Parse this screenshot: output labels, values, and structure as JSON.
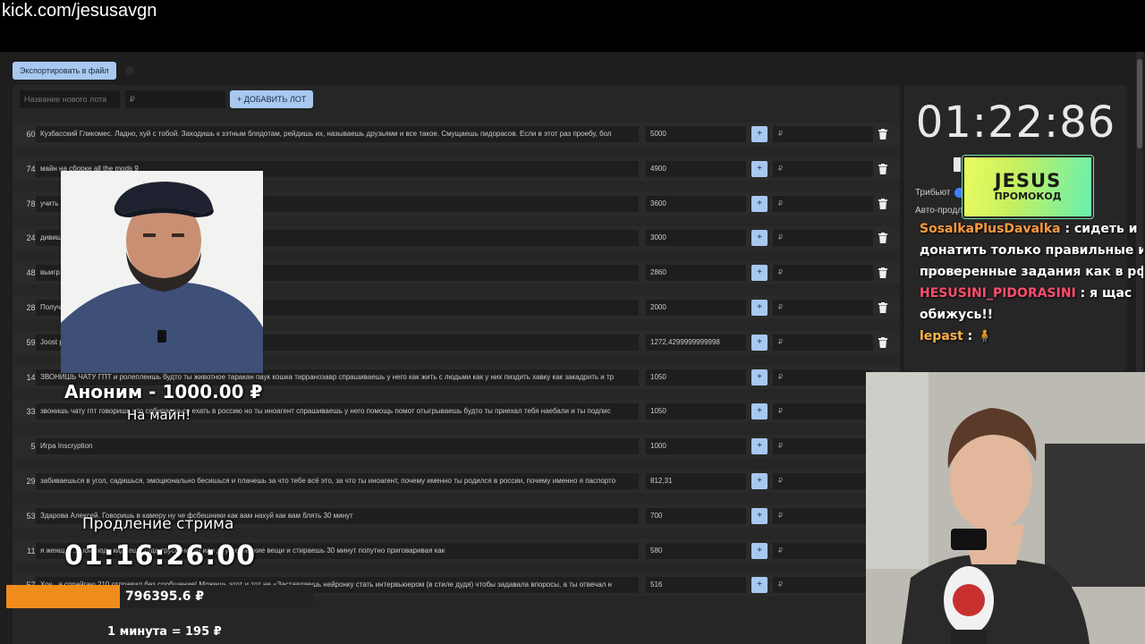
{
  "browser": {
    "url": "kick.com/jesusavgn"
  },
  "toolbar": {
    "export_label": "Экспортировать в файл"
  },
  "new_lot": {
    "name_placeholder": "Название нового лота",
    "price_placeholder": "₽",
    "add_label": "+ ДОБАВИТЬ ЛОТ"
  },
  "lots": [
    {
      "num": "60.",
      "desc": "Кузбасский Гликомес. Ладно, хуй с тобой. Заходишь к зэтным блядотам, рейдишь их, называешь друзьями и все такое. Смущаешь пидорасов. Если в этот раз проебу, бол",
      "amount": "5000",
      "plus": "+",
      "add_placeholder": "₽"
    },
    {
      "num": "74.",
      "desc": "майн на сборке all the mods 9",
      "amount": "4900",
      "plus": "+",
      "add_placeholder": "₽"
    },
    {
      "num": "78.",
      "desc": "учить",
      "amount": "3600",
      "plus": "+",
      "add_placeholder": "₽"
    },
    {
      "num": "24.",
      "desc": "дивиш",
      "amount": "3000",
      "plus": "+",
      "add_placeholder": "₽"
    },
    {
      "num": "48.",
      "desc": "выигр",
      "amount": "2860",
      "plus": "+",
      "add_placeholder": "₽"
    },
    {
      "num": "28.",
      "desc": "Получ                                                                                              ы",
      "amount": "2000",
      "plus": "+",
      "add_placeholder": "₽"
    },
    {
      "num": "59.",
      "desc": "Joost                                                                                       p=iAQBsAgC",
      "amount": "1272,4299999999998",
      "plus": "+",
      "add_placeholder": "₽"
    },
    {
      "num": "14.",
      "desc": "ЗВОНИШЬ ЧАТУ ГПТ и ролеплеишь будто ты животное таракан паук кошка тирранозавр спрашиваешь у него как жить с людьми как у них пиздить хавку как закадрить и тр",
      "amount": "1050",
      "plus": "+",
      "add_placeholder": "₽"
    },
    {
      "num": "33.",
      "desc": "звонишь чату гпт говоришь что собираешься ехать в россию но ты иноагент спрашиваешь у него помощь помот отыгрываешь будто ты приехал тебя наебали и ты подпис",
      "amount": "1050",
      "plus": "+",
      "add_placeholder": "₽"
    },
    {
      "num": "5.",
      "desc": "Игра Inscryption",
      "amount": "1000",
      "plus": "+",
      "add_placeholder": "₽"
    },
    {
      "num": "29.",
      "desc": "забиваешься в угол, садишься, эмоционально бесишься и плачешь за что тебе всё это, за что ты иноагент, почему именно ты родился в россии, почему именно я паспорто",
      "amount": "812,31",
      "plus": "+",
      "add_placeholder": "₽"
    },
    {
      "num": "53.",
      "desc": "Здарова Алексей. Говоришь в камеру ну че фсбешники как вам нахуй как вам блять 30 минут",
      "amount": "700",
      "plus": "+",
      "add_placeholder": "₽"
    },
    {
      "num": "11.",
      "desc": "я женщ...                          ...шою воду кидаешь туда трусы носки или другие мелкие вещи и стираешь 30 минут попутно приговаривая как",
      "amount": "580",
      "plus": "+",
      "add_placeholder": "₽"
    },
    {
      "num": "57.",
      "desc": "Хоч...я спрайгаю 210 отправил без сообщение! Можешь этот и тот не «Заставляешь нейронку стать интервьюером (в стиле дудя) чтобы задавала впоросы, а ты отвечал н",
      "amount": "516",
      "plus": "+",
      "add_placeholder": "₽"
    }
  ],
  "timer": {
    "display": "01:22:86",
    "tribute_label": "Трибьют",
    "autoext_label": "Авто-продл",
    "dimmed_amount": "1000.00 ₽"
  },
  "promo_badge": {
    "title": "JESUS",
    "subtitle": "ПРОМОКОД"
  },
  "chat": [
    {
      "user": "SosalkaPlusDavalka",
      "user_color": "#ff9a3c",
      "text": " : сидеть и"
    },
    {
      "user": "",
      "user_color": "#ffffff",
      "text": "донатить только прaвильные и"
    },
    {
      "user": "",
      "user_color": "#ffffff",
      "text": "проверенные задания как в рф"
    },
    {
      "user": "HESUSINI_PIDORASINI",
      "user_color": "#ff4d6d",
      "text": " : я щас"
    },
    {
      "user": "",
      "user_color": "#ffffff",
      "text": "обижусь!!"
    },
    {
      "user": "lepast",
      "user_color": "#ffb347",
      "text": " : 🧍"
    }
  ],
  "donation": {
    "donor_line": "Аноним - 1000.00 ₽",
    "message": "На майн!"
  },
  "extension": {
    "label": "Продление стрима",
    "timer": "01:16:26:00"
  },
  "goal": {
    "value": "796395.6 ₽",
    "fill_percent": 37,
    "fill_color": "#f08c1c"
  },
  "rate": {
    "text": "1 минута = 195 ₽"
  }
}
